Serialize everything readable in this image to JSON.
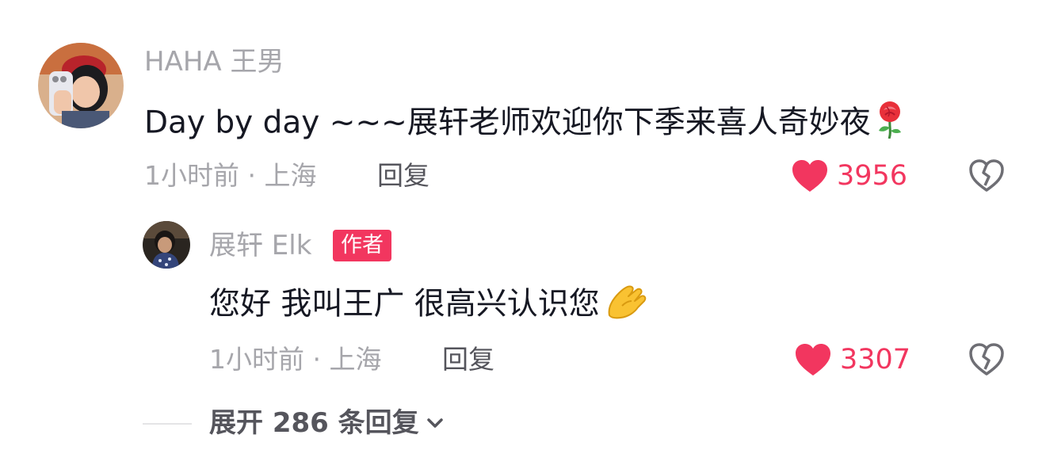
{
  "comment": {
    "username": "HAHA 王男",
    "text": "Day by day ~~~展轩老师欢迎你下季来喜人奇妙夜",
    "emoji_icon": "rose-emoji-icon",
    "meta": "1小时前 · 上海",
    "reply_label": "回复",
    "like_count": "3956"
  },
  "reply": {
    "username": "展轩 Elk",
    "badge": "作者",
    "text": "您好 我叫王广 很高兴认识您",
    "emoji_icon": "hand-emoji-icon",
    "meta": "1小时前 · 上海",
    "reply_label": "回复",
    "like_count": "3307"
  },
  "expand": {
    "label": "展开 286 条回复"
  },
  "colors": {
    "accent": "#f2365f",
    "text_primary": "#161823",
    "text_secondary": "#a6a6ab"
  }
}
